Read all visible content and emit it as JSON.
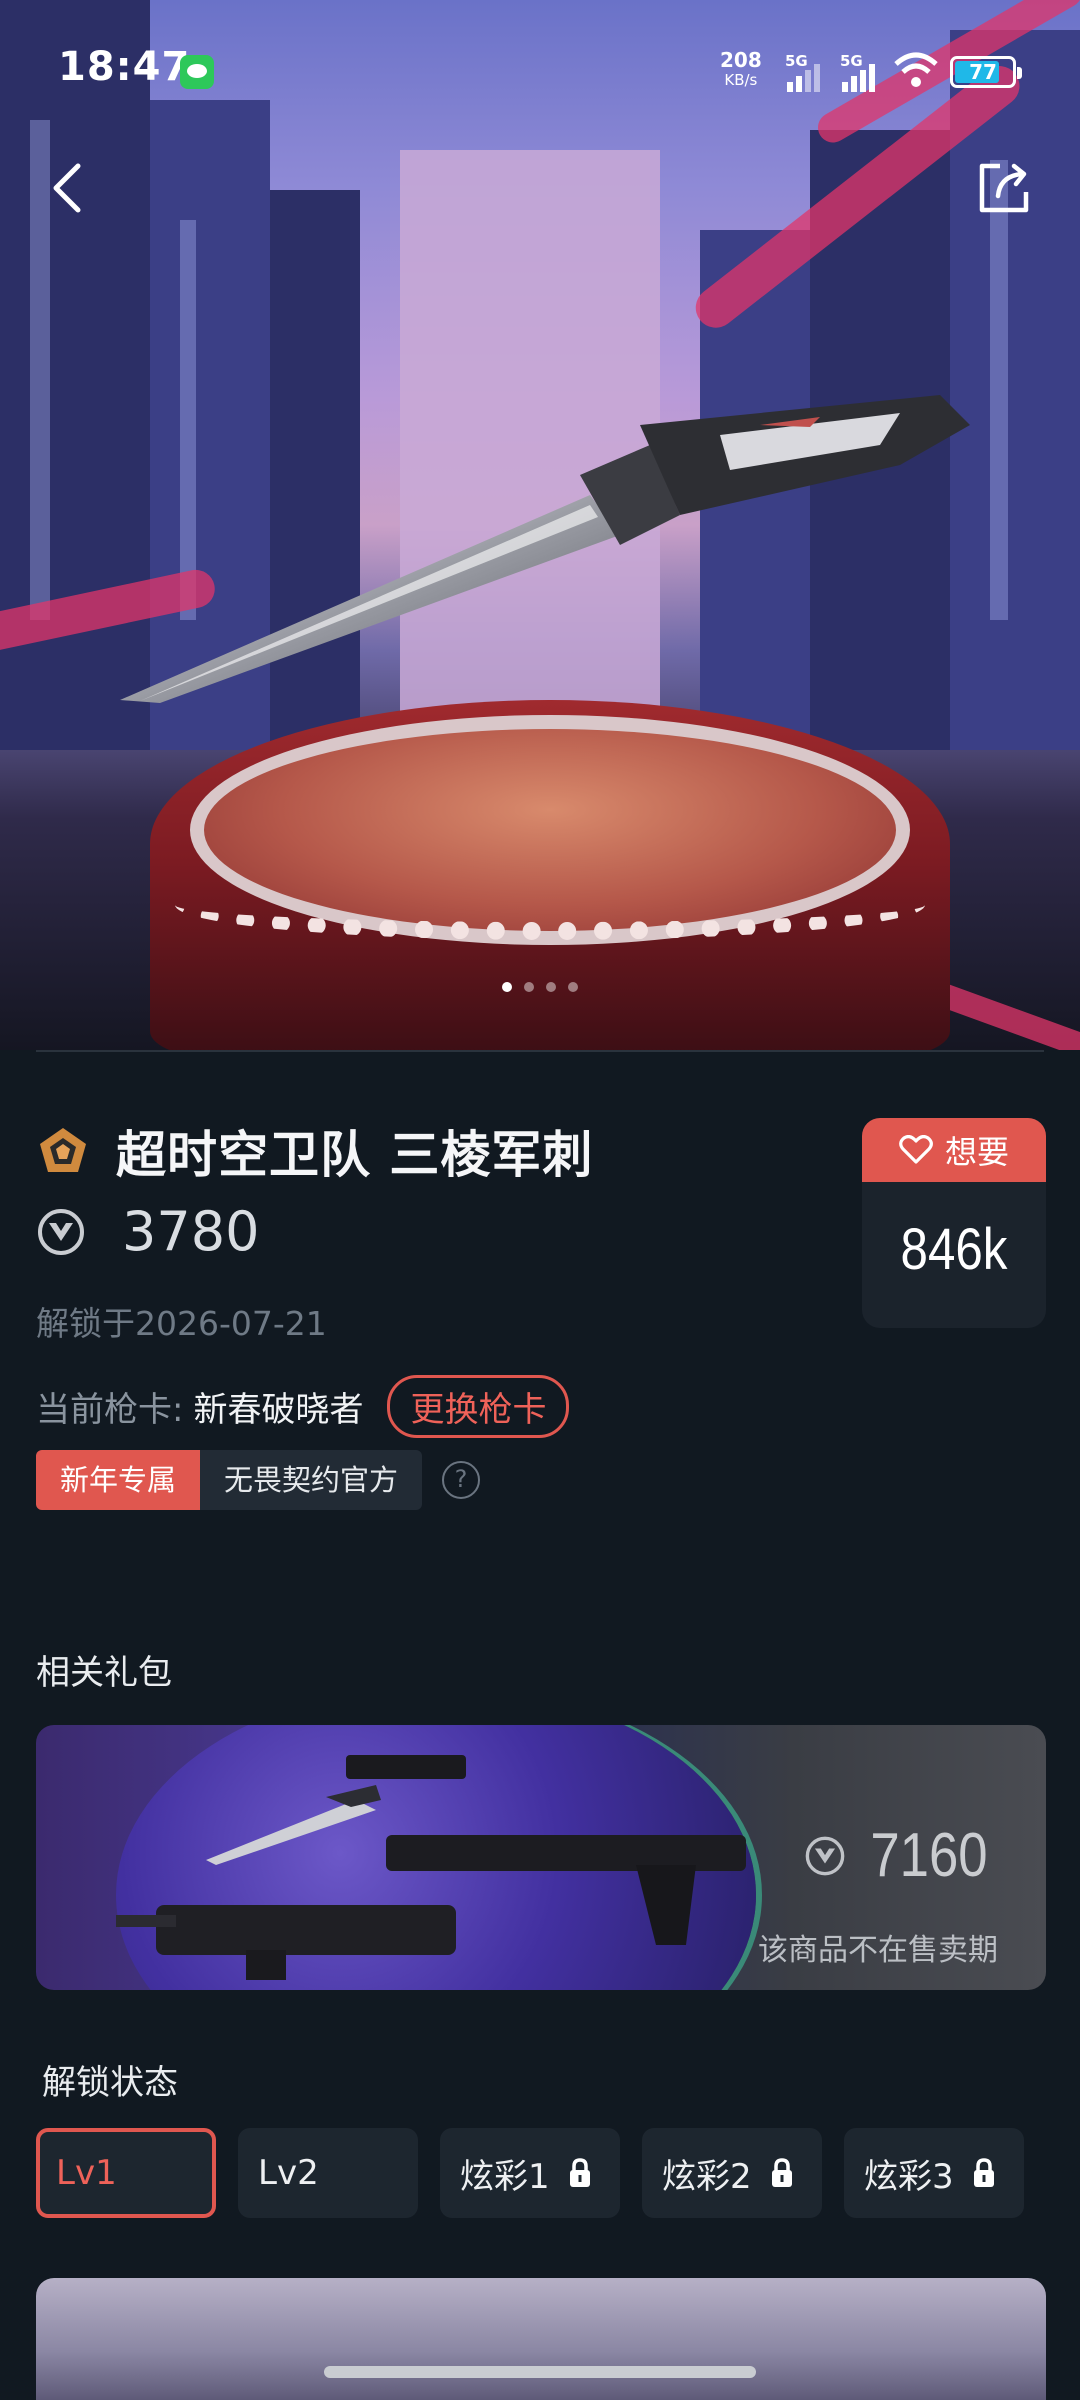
{
  "status_bar": {
    "time": "18:47",
    "net_speed": "208",
    "net_unit": "KB/s",
    "sim1": "5G",
    "sim2": "5G",
    "battery": "77"
  },
  "hero": {
    "slide_count": 4,
    "active_slide": 1
  },
  "item": {
    "name": "超时空卫队 三棱军刺",
    "price": "3780",
    "unlock_date": "解锁于2026-07-21",
    "card_label": "当前枪卡:",
    "card_value": "新春破晓者",
    "card_change": "更换枪卡",
    "tags": [
      "新年专属",
      "无畏契约官方"
    ],
    "help": "?"
  },
  "want": {
    "label": "想要",
    "count": "846k"
  },
  "bundle": {
    "section_title": "相关礼包",
    "price": "7160",
    "note": "该商品不在售卖期"
  },
  "unlock_states": {
    "section_title": "解锁状态",
    "items": [
      {
        "label": "Lv1",
        "locked": false,
        "active": true
      },
      {
        "label": "Lv2",
        "locked": false,
        "active": false
      },
      {
        "label": "炫彩1",
        "locked": true,
        "active": false
      },
      {
        "label": "炫彩2",
        "locked": true,
        "active": false
      },
      {
        "label": "炫彩3",
        "locked": true,
        "active": false
      }
    ]
  },
  "colors": {
    "accent": "#e0574f",
    "background": "#111921",
    "card": "#1d262f"
  }
}
